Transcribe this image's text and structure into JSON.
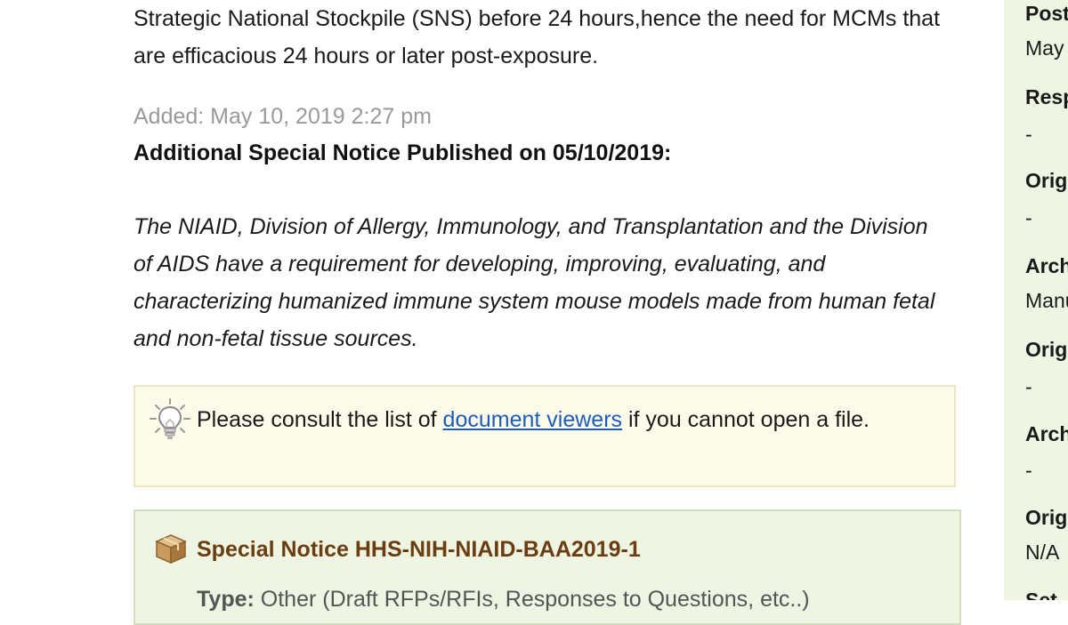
{
  "main": {
    "top_paragraph": "Strategic National Stockpile (SNS) before 24 hours,hence the need for MCMs that are efficacious 24 hours or later post-exposure.",
    "added": "Added: May 10, 2019 2:27 pm",
    "notice_heading": "Additional Special Notice Published on 05/10/2019:",
    "notice_body": "The NIAID, Division of Allergy, Immunology, and Transplantation and the Division of AIDS have a requirement for developing, improving, evaluating, and characterizing humanized immune system mouse models made from human fetal and non-fetal tissue sources."
  },
  "tip": {
    "icon": "lightbulb-icon",
    "prefix": "Please consult the list of ",
    "link": "document viewers",
    "suffix": " if you cannot open a file."
  },
  "notice_box": {
    "icon": "package-icon",
    "title": "Special Notice HHS-NIH-NIAID-BAA2019-1",
    "type_label": "Type:",
    "type_value": " Other (Draft RFPs/RFIs, Responses to Questions, etc..)"
  },
  "sidebar": {
    "items": [
      {
        "label": "Posted",
        "value": "May"
      },
      {
        "label": "Response",
        "value": "-"
      },
      {
        "label": "Original",
        "value": "-"
      },
      {
        "label": "Archive",
        "value": "Manual"
      },
      {
        "label": "Original",
        "value": "-"
      },
      {
        "label": "Archive",
        "value": "-"
      },
      {
        "label": "Original",
        "value": "N/A"
      },
      {
        "label": "Set",
        "value": ""
      }
    ]
  },
  "colors": {
    "link": "#1f5cb8",
    "notice_title": "#6b3d10",
    "tip_bg": "#fcfbea",
    "panel_bg": "#eef5e2",
    "muted_text": "#9a9a9a"
  }
}
